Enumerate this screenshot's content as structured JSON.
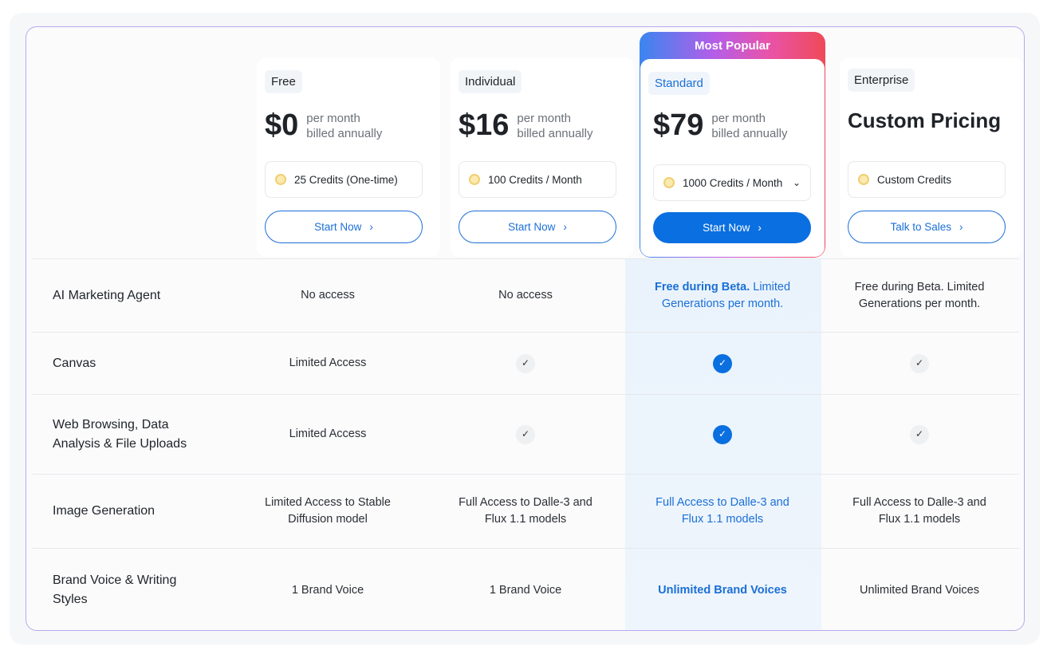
{
  "plans": [
    {
      "name": "Free",
      "price": "$0",
      "per": "per month",
      "billed": "billed annually",
      "credits": "25 Credits (One-time)",
      "cta": "Start Now"
    },
    {
      "name": "Individual",
      "price": "$16",
      "per": "per month",
      "billed": "billed annually",
      "credits": "100 Credits / Month",
      "cta": "Start Now"
    },
    {
      "name": "Standard",
      "ribbon": "Most Popular",
      "price": "$79",
      "per": "per month",
      "billed": "billed annually",
      "credits": "1000 Credits / Month",
      "cta": "Start Now"
    },
    {
      "name": "Enterprise",
      "price": "Custom Pricing",
      "credits": "Custom Credits",
      "cta": "Talk to Sales"
    }
  ],
  "features": [
    {
      "label": "AI Marketing Agent",
      "values": [
        "No access",
        "No access",
        "Free during Beta. Limited Generations per month.",
        "Free during Beta. Limited Generations per month."
      ],
      "std_bold": "Free during Beta.",
      "std_rest": " Limited Generations per month."
    },
    {
      "label": "Canvas",
      "values": [
        "Limited Access",
        "check",
        "check",
        "check"
      ]
    },
    {
      "label": "Web Browsing, Data Analysis & File Uploads",
      "values": [
        "Limited Access",
        "check",
        "check",
        "check"
      ]
    },
    {
      "label": "Image Generation",
      "values": [
        "Limited Access to Stable Diffusion model",
        "Full Access to Dalle-3 and Flux 1.1 models",
        "Full Access to Dalle-3 and Flux 1.1 models",
        "Full Access to Dalle-3 and Flux 1.1 models"
      ]
    },
    {
      "label": "Brand Voice & Writing Styles",
      "values": [
        "1 Brand Voice",
        "1 Brand Voice",
        "Unlimited Brand Voices",
        "Unlimited Brand Voices"
      ]
    }
  ],
  "colors": {
    "accent": "#0a6fe0",
    "border": "#b9a8f0"
  }
}
